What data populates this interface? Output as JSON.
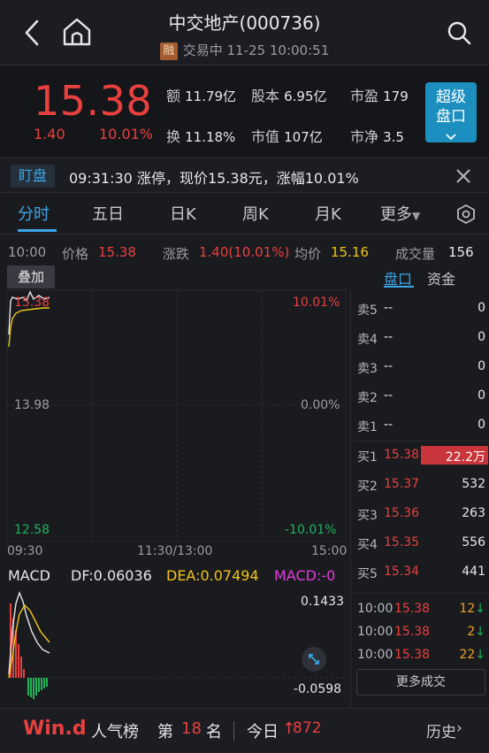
{
  "header": {
    "title": "中交地产(000736)",
    "tag": "融",
    "status": "交易中 11-25 10:00:51"
  },
  "quote": {
    "price": "15.38",
    "change": "1.40",
    "change_pct": "10.01%",
    "amount_label": "额",
    "amount": "11.79亿",
    "shares_label": "股本",
    "shares": "6.95亿",
    "pe_label": "市盈",
    "pe": "179",
    "turnover_label": "换",
    "turnover": "11.18%",
    "mcap_label": "市值",
    "mcap": "107亿",
    "pb_label": "市净",
    "pb": "3.5",
    "super_label_1": "超级",
    "super_label_2": "盘口"
  },
  "watch": {
    "tag": "盯盘",
    "message": "09:31:30 涨停，现价15.38元，涨幅10.01%"
  },
  "tabs": [
    "分时",
    "五日",
    "日K",
    "周K",
    "月K",
    "更多"
  ],
  "info": {
    "time": "10:00",
    "price_label": "价格",
    "price": "15.38",
    "change_label": "涨跌",
    "change": "1.40(10.01%)",
    "avg_label": "均价",
    "avg": "15.16",
    "vol_label": "成交量",
    "vol": "156"
  },
  "chart": {
    "overlay": "叠加",
    "top_price": "15.38",
    "mid_price": "13.98",
    "low_price": "12.58",
    "top_pct": "10.01%",
    "mid_pct": "0.00%",
    "low_pct": "-10.01%",
    "time_start": "09:30",
    "time_mid": "11:30/13:00",
    "time_end": "15:00"
  },
  "orderbook": {
    "tab_active": "盘口",
    "tab_other": "资金",
    "asks": [
      {
        "label": "卖5",
        "price": "--",
        "vol": "0"
      },
      {
        "label": "卖4",
        "price": "--",
        "vol": "0"
      },
      {
        "label": "卖3",
        "price": "--",
        "vol": "0"
      },
      {
        "label": "卖2",
        "price": "--",
        "vol": "0"
      },
      {
        "label": "卖1",
        "price": "--",
        "vol": "0"
      }
    ],
    "bids": [
      {
        "label": "买1",
        "price": "15.38",
        "vol": "22.2万"
      },
      {
        "label": "买2",
        "price": "15.37",
        "vol": "532"
      },
      {
        "label": "买3",
        "price": "15.36",
        "vol": "263"
      },
      {
        "label": "买4",
        "price": "15.35",
        "vol": "556"
      },
      {
        "label": "买5",
        "price": "15.34",
        "vol": "441"
      }
    ],
    "trades": [
      {
        "time": "10:00",
        "price": "15.38",
        "vol": "12"
      },
      {
        "time": "10:00",
        "price": "15.38",
        "vol": "2"
      },
      {
        "time": "10:00",
        "price": "15.38",
        "vol": "22"
      }
    ],
    "more_trades": "更多成交"
  },
  "macd": {
    "name": "MACD",
    "dif": "DF:0.06036",
    "dea": "DEA:0.07494",
    "macd": "MACD:-0",
    "max": "0.1433",
    "min": "-0.0598"
  },
  "bottom": {
    "brand": "Win.d",
    "rank_label": "人气榜",
    "rank_prefix": "第",
    "rank": "18",
    "rank_suffix": "名",
    "today_label": "今日",
    "today_value": "872",
    "history": "历史"
  },
  "colors": {
    "up": "#e8403f",
    "down": "#21b35c",
    "accent": "#3aa5e8",
    "avg_line": "#f0c419"
  }
}
